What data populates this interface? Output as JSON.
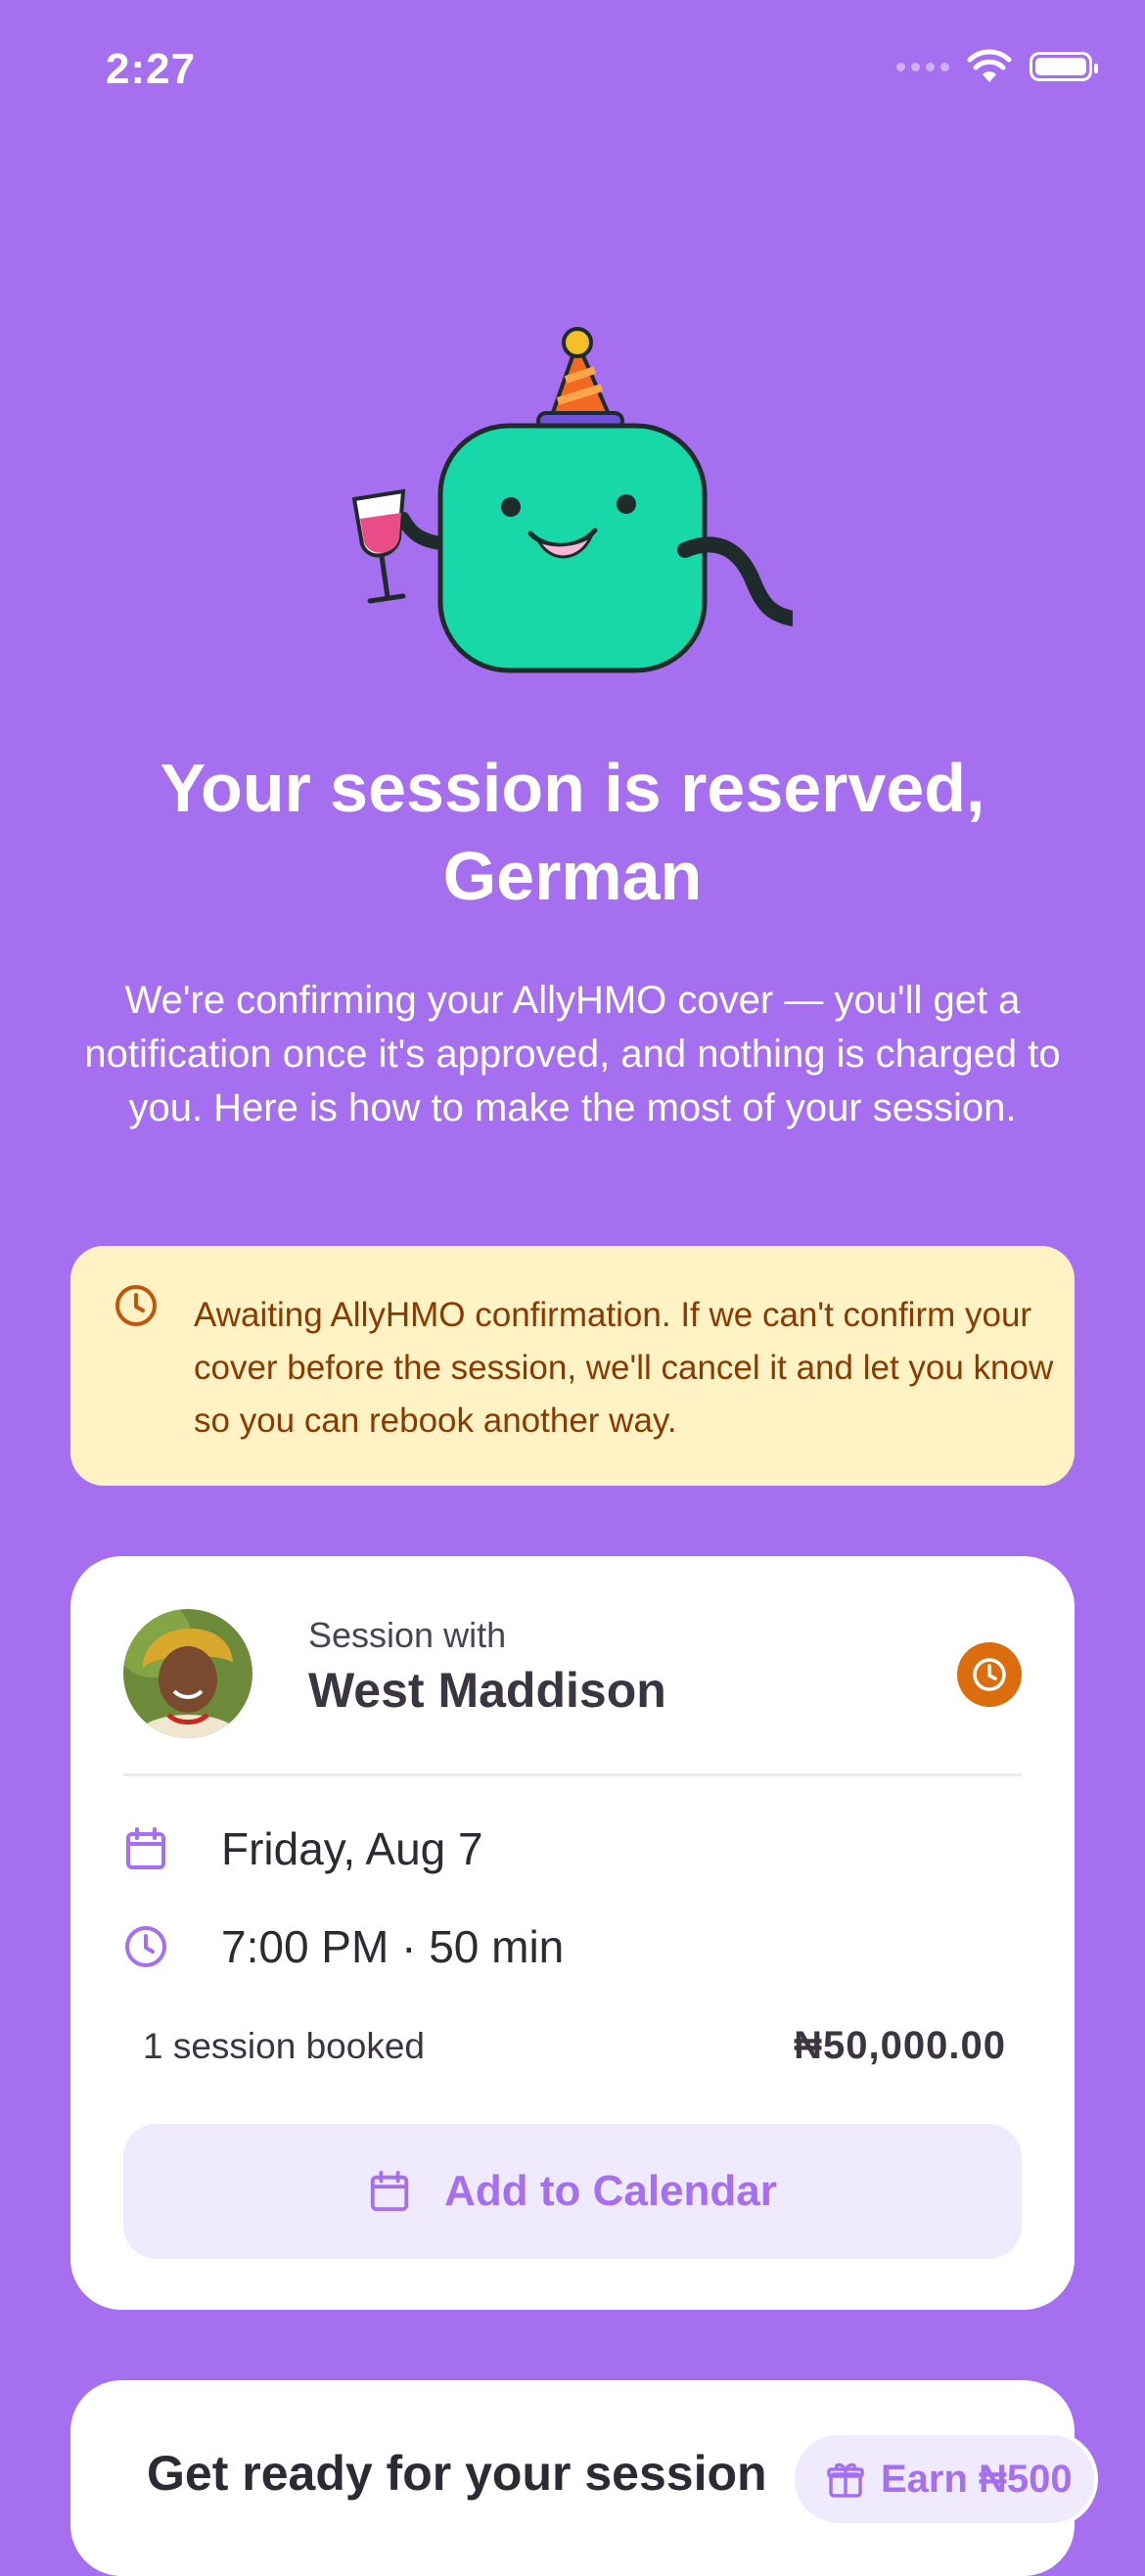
{
  "status_bar": {
    "time": "2:27"
  },
  "header": {
    "title": "Your session is reserved, German",
    "subtitle": "We're confirming your AllyHMO cover — you'll get a notification once it's approved, and nothing is charged to you. Here is how to make the most of your session."
  },
  "notice": {
    "icon": "clock-icon",
    "text": "Awaiting AllyHMO confirmation. If we can't confirm your cover before the session, we'll cancel it and let you know so you can rebook another way."
  },
  "session_card": {
    "session_with_label": "Session with",
    "therapist_name": "West Maddison",
    "status_icon": "clock-icon",
    "date": "Friday, Aug 7",
    "time": "7:00 PM · 50 min",
    "sessions_booked": "1 session booked",
    "price": "₦50,000.00",
    "add_to_calendar_label": "Add to Calendar"
  },
  "prep_card": {
    "title": "Get ready for your session",
    "earn_label": "Earn ₦500"
  },
  "colors": {
    "background": "#A66FEF",
    "notice_bg": "#FFF3C6",
    "notice_text": "#8A3A00",
    "badge": "#DB6D0E",
    "button_bg": "#F0EAFE"
  }
}
